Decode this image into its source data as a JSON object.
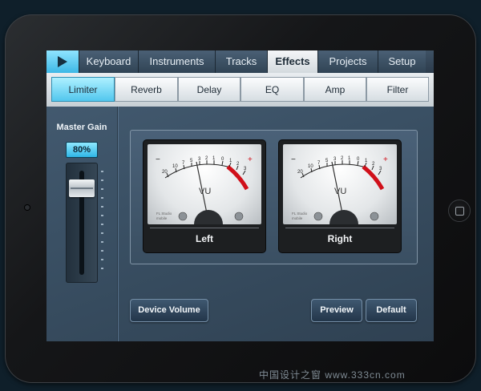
{
  "tabs": {
    "play_icon": "play-icon",
    "items": [
      {
        "label": "Keyboard",
        "active": false
      },
      {
        "label": "Instruments",
        "active": false
      },
      {
        "label": "Tracks",
        "active": false
      },
      {
        "label": "Effects",
        "active": true
      },
      {
        "label": "Projects",
        "active": false
      },
      {
        "label": "Setup",
        "active": false
      }
    ]
  },
  "effects": [
    {
      "label": "Limiter",
      "active": true
    },
    {
      "label": "Reverb",
      "active": false
    },
    {
      "label": "Delay",
      "active": false
    },
    {
      "label": "EQ",
      "active": false
    },
    {
      "label": "Amp",
      "active": false
    },
    {
      "label": "Filter",
      "active": false
    }
  ],
  "master_gain": {
    "label": "Master Gain",
    "value_text": "80%",
    "value": 0.8
  },
  "meters": {
    "scale": [
      "20",
      "10",
      "7",
      "5",
      "3",
      "2",
      "1",
      "0",
      "1",
      "2",
      "3"
    ],
    "minus_sign": "−",
    "plus_sign": "+",
    "vu_label": "VU",
    "brand_line1": "FL Studio",
    "brand_line2": "mobile",
    "left": {
      "label": "Left"
    },
    "right": {
      "label": "Right"
    }
  },
  "buttons": {
    "device_volume": "Device Volume",
    "preview": "Preview",
    "default": "Default"
  },
  "watermark": "中国设计之窗  www.333cn.com",
  "colors": {
    "accent": "#52c7ee",
    "meter_red": "#d0101a"
  }
}
